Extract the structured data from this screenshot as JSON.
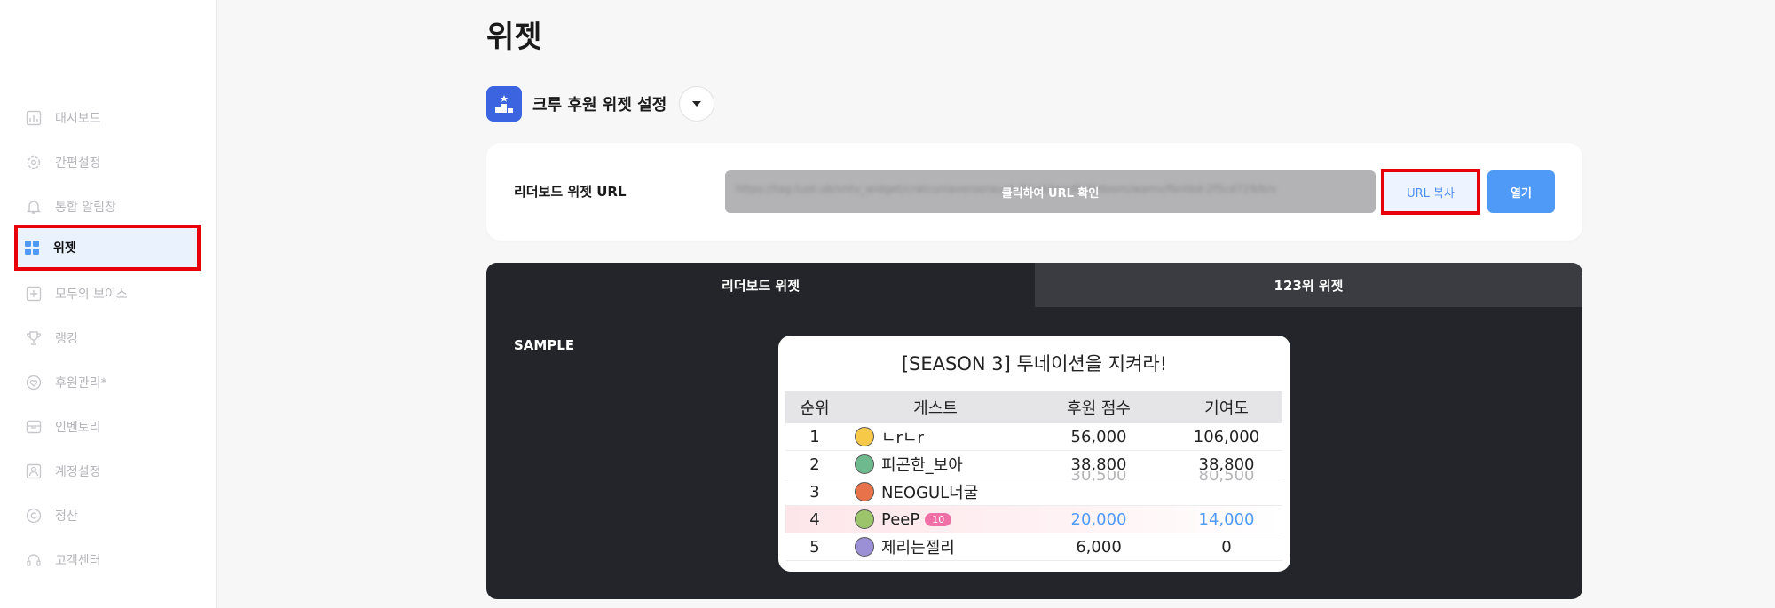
{
  "sidebar": {
    "items": [
      {
        "label": "대시보드",
        "icon": "chart-icon"
      },
      {
        "label": "간편설정",
        "icon": "gear-icon"
      },
      {
        "label": "통합 알림창",
        "icon": "bell-icon"
      },
      {
        "label": "위젯",
        "icon": "grid-icon",
        "active": true
      },
      {
        "label": "모두의 보이스",
        "icon": "voice-icon"
      },
      {
        "label": "랭킹",
        "icon": "trophy-icon"
      },
      {
        "label": "후원관리*",
        "icon": "heart-icon"
      },
      {
        "label": "인벤토리",
        "icon": "box-icon"
      },
      {
        "label": "계정설정",
        "icon": "user-icon"
      },
      {
        "label": "정산",
        "icon": "copyright-icon"
      },
      {
        "label": "고객센터",
        "icon": "headset-icon"
      }
    ]
  },
  "page": {
    "title": "위젯"
  },
  "widget_select": {
    "label": "크루 후원 위젯 설정"
  },
  "url_card": {
    "label": "리더보드 위젯 URL",
    "blurred_url": "https://tag.tuot.ub/vntv_widget/cratcuniaverooraunbdhtwkhmrdb/drdoom/wamv/fbntbd-2f5cd729/b/v",
    "hint": "클릭하여 URL 확인",
    "copy_label": "URL 복사",
    "open_label": "열기"
  },
  "tabs": [
    {
      "label": "리더보드 위젯"
    },
    {
      "label": "123위 위젯"
    }
  ],
  "sample_label": "SAMPLE",
  "leaderboard": {
    "title": "[SEASON 3] 투네이션을 지켜라!",
    "headers": {
      "rank": "순위",
      "guest": "게스트",
      "score": "후원 점수",
      "contrib": "기여도"
    },
    "rows": [
      {
        "rank": "1",
        "guest": "ㄴrㄴr",
        "score": "56,000",
        "contrib": "106,000"
      },
      {
        "rank": "2",
        "guest": "피곤한_보아",
        "score": "38,800",
        "contrib": "38,800"
      },
      {
        "rank": "3",
        "guest": "NEOGUL너굴",
        "score": "",
        "contrib": ""
      },
      {
        "rank": "4",
        "guest": "PeeP",
        "badge": "10",
        "score": "20,000",
        "contrib": "14,000"
      },
      {
        "rank": "5",
        "guest": "제리는젤리",
        "score": "6,000",
        "contrib": "0"
      }
    ],
    "ghost": {
      "score": "30,500",
      "contrib": "80,500"
    }
  },
  "colors": {
    "accent": "#4f9af7",
    "brand": "#3c63e0",
    "highlight_border": "#e8000b",
    "dark_panel": "#23252a"
  }
}
